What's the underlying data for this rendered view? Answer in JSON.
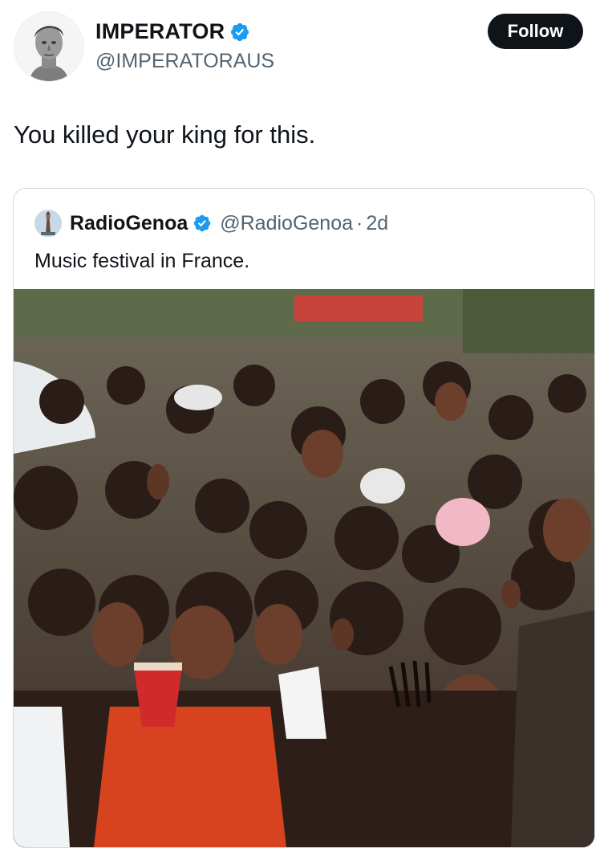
{
  "author": {
    "display_name": "IMPERATOR",
    "handle": "@IMPERATORAUS",
    "verified": true,
    "avatar_icon": "bust-statue-avatar"
  },
  "follow_button": {
    "label": "Follow"
  },
  "tweet": {
    "text": "You killed your king for this."
  },
  "quoted": {
    "display_name": "RadioGenoa",
    "handle": "@RadioGenoa",
    "separator": "·",
    "time": "2d",
    "text": "Music festival in France.",
    "verified": true,
    "avatar_icon": "lighthouse-avatar",
    "media_icon": "crowd-video-thumbnail"
  },
  "colors": {
    "verified_blue": "#1d9bf0",
    "text_primary": "#0f1419",
    "text_secondary": "#536471",
    "border": "#cfd9de",
    "follow_bg": "#0f1419"
  }
}
